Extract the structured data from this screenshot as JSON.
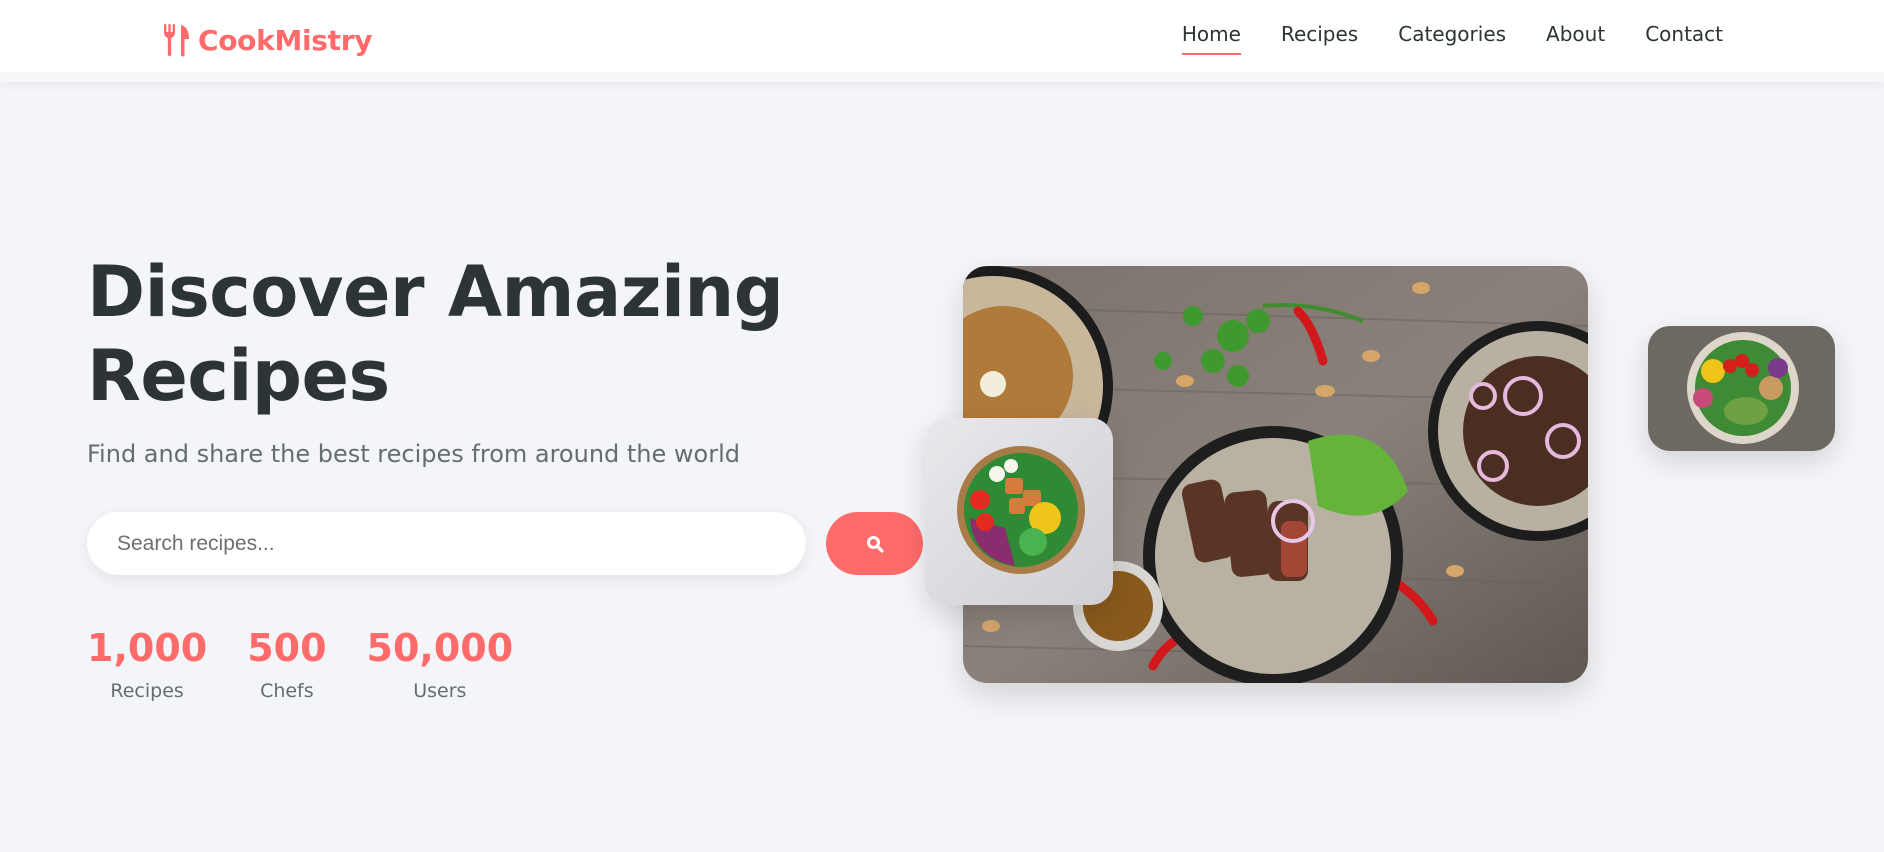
{
  "brand": {
    "name": "CookMistry",
    "icon": "utensils-icon",
    "color": "#ff6b6b"
  },
  "nav": {
    "items": [
      {
        "label": "Home",
        "active": true
      },
      {
        "label": "Recipes",
        "active": false
      },
      {
        "label": "Categories",
        "active": false
      },
      {
        "label": "About",
        "active": false
      },
      {
        "label": "Contact",
        "active": false
      }
    ]
  },
  "hero": {
    "title_line1": "Discover Amazing",
    "title_line2": "Recipes",
    "subtitle": "Find and share the best recipes from around the world"
  },
  "search": {
    "placeholder": "Search recipes...",
    "value": "",
    "button_icon": "search-icon"
  },
  "stats": [
    {
      "value": "1,000",
      "label": "Recipes"
    },
    {
      "value": "500",
      "label": "Chefs"
    },
    {
      "value": "50,000",
      "label": "Users"
    }
  ],
  "images": {
    "main": "food-spread-photo",
    "card_left": "salad-bowl-photo",
    "card_right": "buddha-bowl-photo"
  },
  "colors": {
    "accent": "#ff6b6b",
    "heading": "#2d3436",
    "muted": "#636e72",
    "background": "#f4f5f8"
  }
}
